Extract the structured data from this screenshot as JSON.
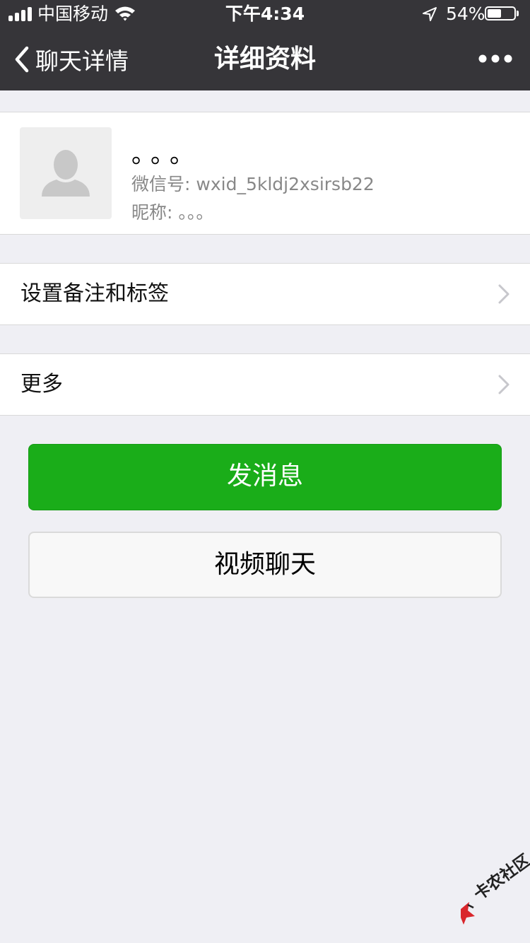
{
  "status_bar": {
    "carrier": "中国移动",
    "time": "下午4:34",
    "battery_percent": "54%",
    "battery_level": 0.54,
    "signal_bars": 4,
    "icons": [
      "signal-icon",
      "wifi-icon",
      "location-arrow-icon",
      "battery-icon"
    ]
  },
  "nav": {
    "back_label": "聊天详情",
    "title": "详细资料",
    "icons": [
      "chevron-left-icon",
      "more-dots-icon"
    ]
  },
  "profile": {
    "name": "。。。",
    "wechat_id_label": "微信号:",
    "wechat_id": "wxid_5kldj2xsirsb22",
    "nickname_label": "昵称:",
    "nickname": "。。。",
    "avatar_icon": "default-avatar-icon"
  },
  "cells": {
    "remark_tags": "设置备注和标签",
    "more": "更多",
    "chevron_icon": "chevron-right-icon"
  },
  "buttons": {
    "send_message": "发消息",
    "video_chat": "视频聊天"
  },
  "colors": {
    "nav_bg": "#363539",
    "page_bg": "#efeff4",
    "primary_green": "#1aad19",
    "secondary_text": "#888888"
  },
  "watermark": {
    "text": "卡农社区",
    "icon": "watermark-logo-icon"
  }
}
